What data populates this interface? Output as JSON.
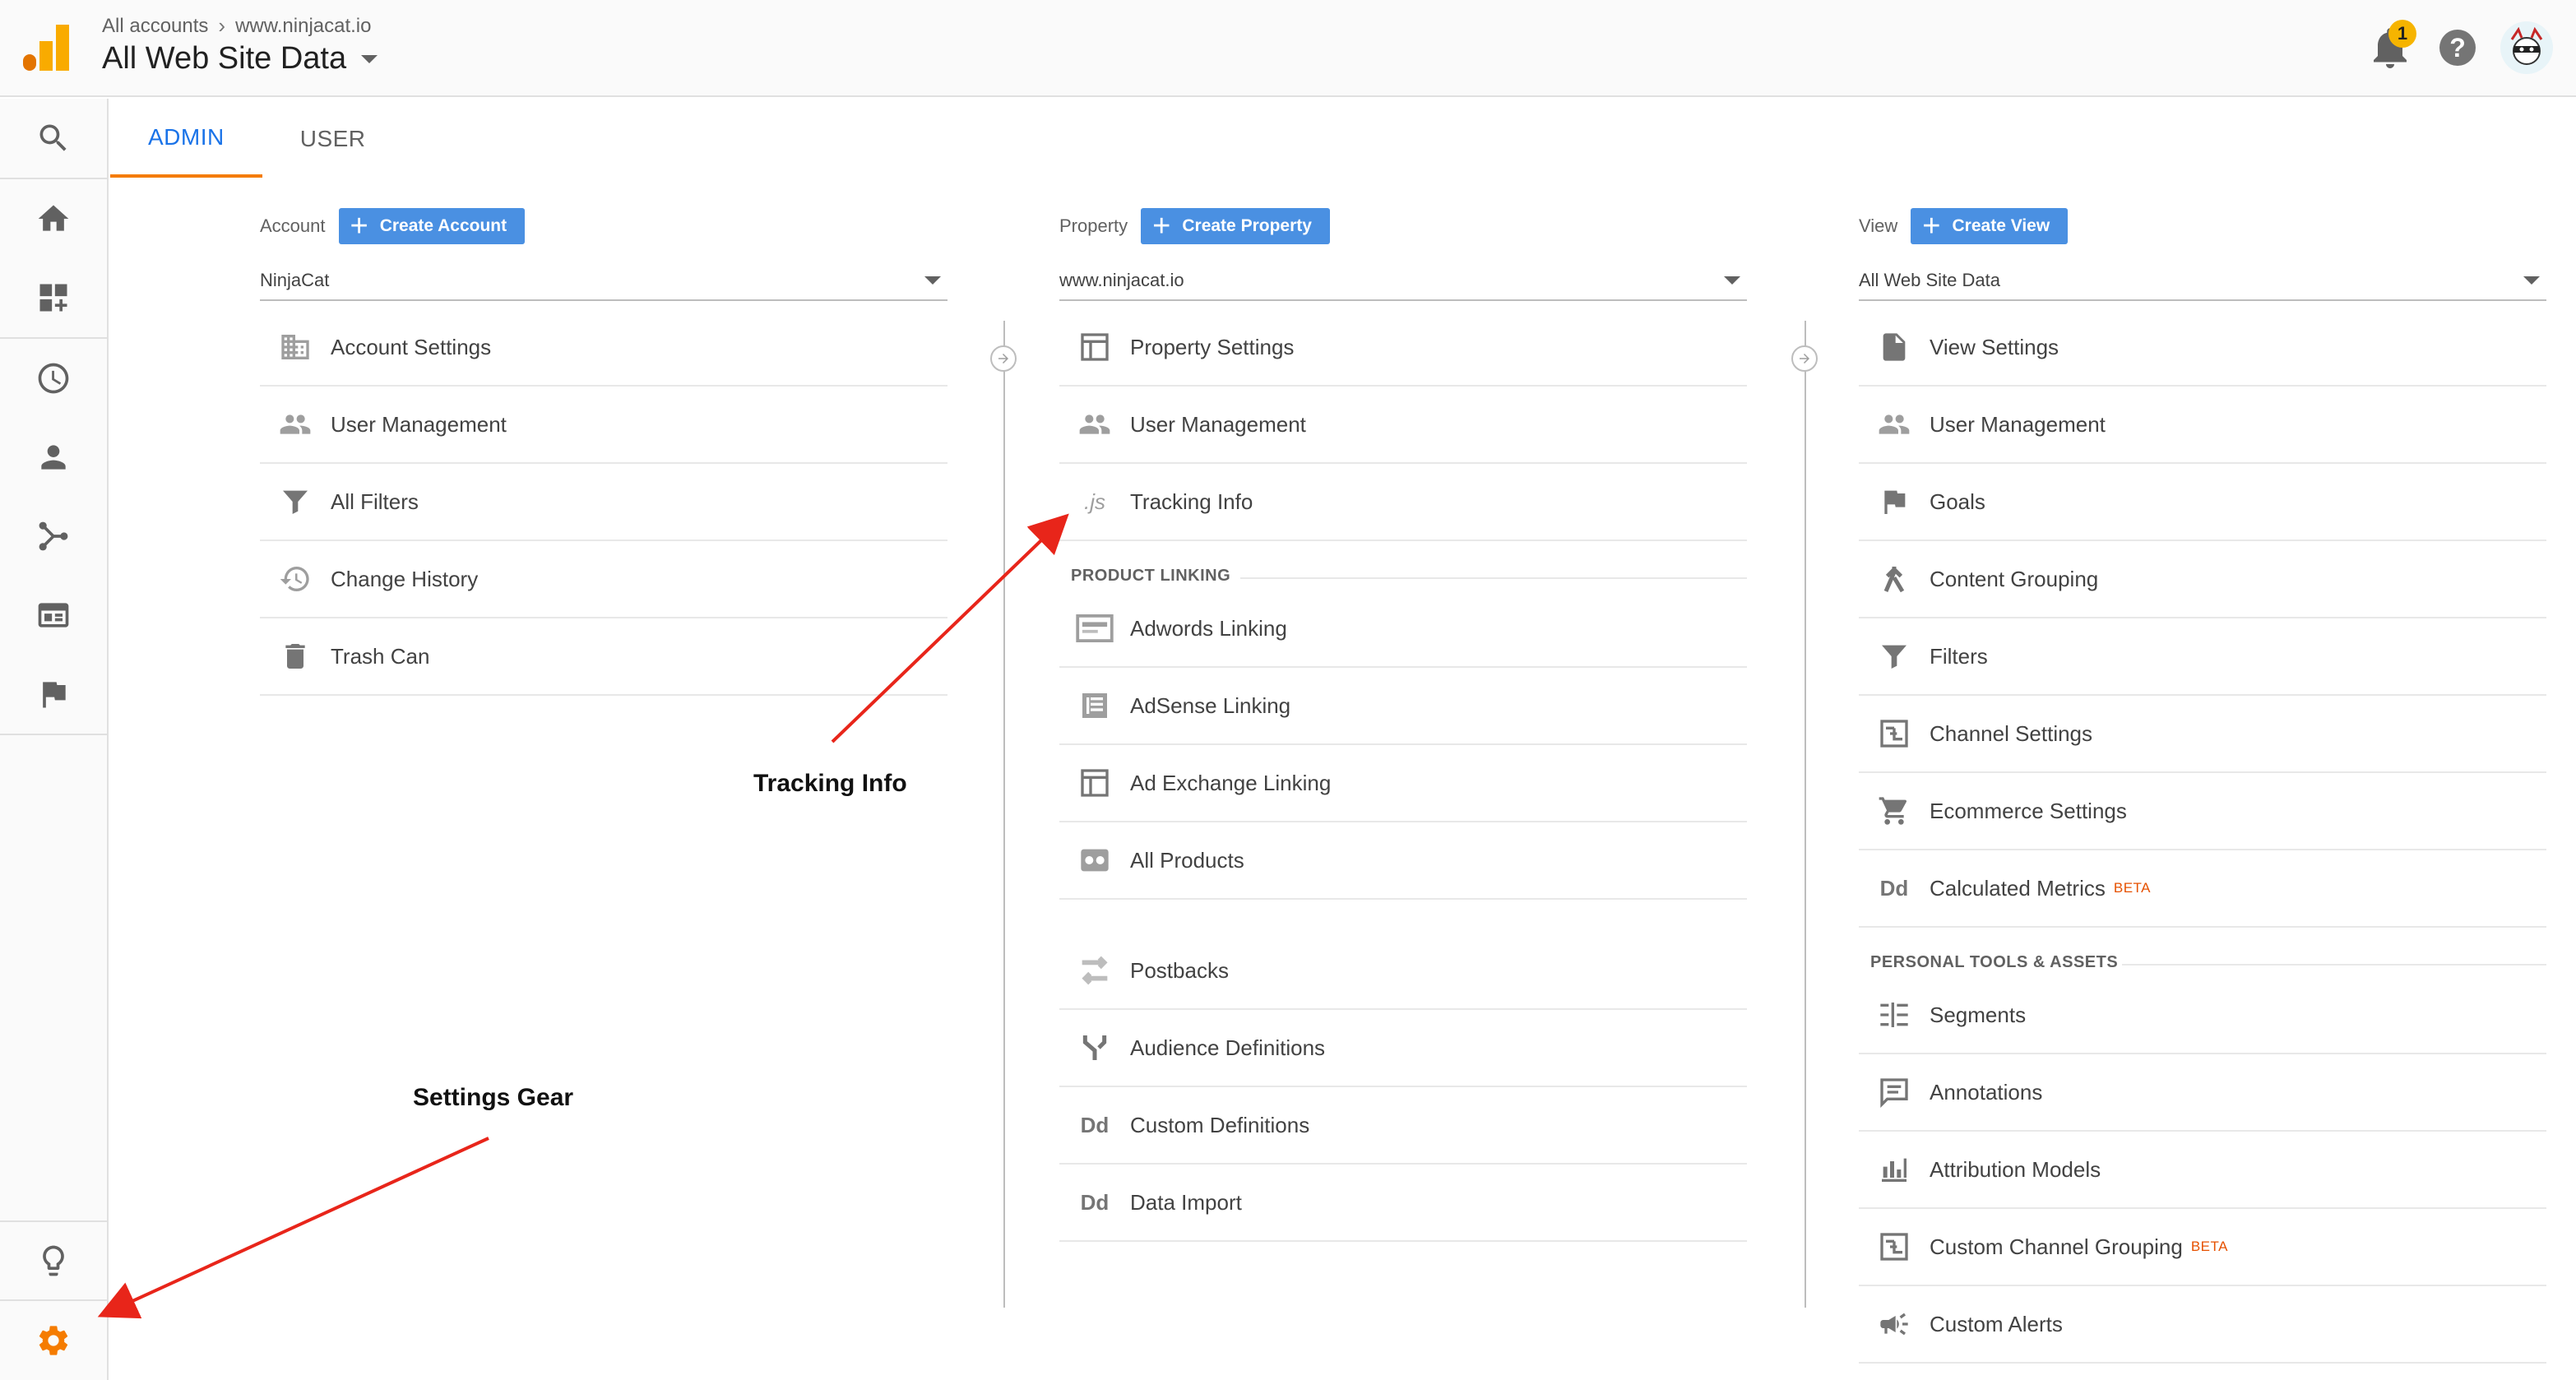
{
  "header": {
    "breadcrumb_root": "All accounts",
    "breadcrumb_site": "www.ninjacat.io",
    "view_title": "All Web Site Data",
    "notification_count": "1",
    "help_symbol": "?"
  },
  "tabs": [
    {
      "label": "ADMIN",
      "active": true
    },
    {
      "label": "USER",
      "active": false
    }
  ],
  "account": {
    "label": "Account",
    "button": "Create Account",
    "selected": "NinjaCat",
    "items": [
      "Account Settings",
      "User Management",
      "All Filters",
      "Change History",
      "Trash Can"
    ]
  },
  "property": {
    "label": "Property",
    "button": "Create Property",
    "selected": "www.ninjacat.io",
    "items": [
      "Property Settings",
      "User Management",
      "Tracking Info"
    ],
    "section_title": "PRODUCT LINKING",
    "linking_items": [
      "Adwords Linking",
      "AdSense Linking",
      "Ad Exchange Linking",
      "All Products"
    ],
    "more_items": [
      "Postbacks",
      "Audience Definitions",
      "Custom Definitions",
      "Data Import"
    ]
  },
  "view": {
    "label": "View",
    "button": "Create View",
    "selected": "All Web Site Data",
    "items": [
      "View Settings",
      "User Management",
      "Goals",
      "Content Grouping",
      "Filters",
      "Channel Settings",
      "Ecommerce Settings",
      "Calculated Metrics"
    ],
    "beta_label": "BETA",
    "section_title": "PERSONAL TOOLS & ASSETS",
    "tools_items": [
      "Segments",
      "Annotations",
      "Attribution Models",
      "Custom Channel Grouping",
      "Custom Alerts"
    ]
  },
  "annotations": {
    "tracking_info": "Tracking Info",
    "settings_gear": "Settings Gear"
  },
  "colors": {
    "accent_blue": "#4a90e2",
    "tab_active": "#1a73e8",
    "tab_underline": "#f57c00",
    "gear": "#f57c00",
    "annotation_arrow": "#e8251a",
    "beta": "#e65100"
  }
}
